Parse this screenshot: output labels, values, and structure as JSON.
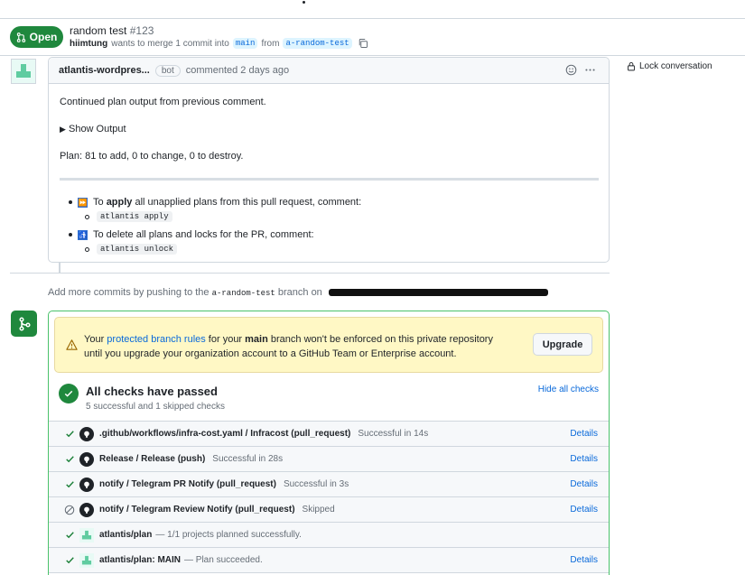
{
  "pr": {
    "state": "Open",
    "title": "random test",
    "number": "#123",
    "author": "hiimtung",
    "merge_text": "wants to merge 1 commit into",
    "base_branch": "main",
    "from_text": "from",
    "head_branch": "a-random-test"
  },
  "comment": {
    "author": "atlantis-wordpres...",
    "badge": "bot",
    "time": "commented 2 days ago",
    "intro": "Continued plan output from previous comment.",
    "show_output": "Show Output",
    "plan": "Plan: 81 to add, 0 to change, 0 to destroy.",
    "apply_prefix": "To ",
    "apply_bold": "apply",
    "apply_rest": " all unapplied plans from this pull request, comment:",
    "apply_cmd": "atlantis apply",
    "unlock_text": "To delete all plans and locks for the PR, comment:",
    "unlock_cmd": "atlantis unlock"
  },
  "sidebar": {
    "lock_label": "Lock conversation"
  },
  "add_commits": {
    "prefix": "Add more commits by pushing to the",
    "branch": "a-random-test",
    "suffix": "branch on"
  },
  "warning": {
    "part1": "Your ",
    "link": "protected branch rules",
    "part2": " for your ",
    "branch": "main",
    "part3": " branch won't be enforced on this private repository until you upgrade your organization account to a GitHub Team or Enterprise account.",
    "button": "Upgrade"
  },
  "checks": {
    "title": "All checks have passed",
    "subtitle": "5 successful and 1 skipped checks",
    "hide_label": "Hide all checks",
    "rows": [
      {
        "status": "success",
        "icon": "github",
        "name": ".github/workflows/infra-cost.yaml / Infracost (pull_request)",
        "desc": "Successful in 14s",
        "details": "Details"
      },
      {
        "status": "success",
        "icon": "github",
        "name": "Release / Release (push)",
        "desc": "Successful in 28s",
        "details": "Details"
      },
      {
        "status": "success",
        "icon": "github",
        "name": "notify / Telegram PR Notify (pull_request)",
        "desc": "Successful in 3s",
        "details": "Details"
      },
      {
        "status": "skipped",
        "icon": "github",
        "name": "notify / Telegram Review Notify (pull_request)",
        "desc": "Skipped",
        "details": "Details"
      },
      {
        "status": "success",
        "icon": "atlantis",
        "name": "atlantis/plan",
        "desc": "— 1/1 projects planned successfully.",
        "details": ""
      },
      {
        "status": "success",
        "icon": "atlantis",
        "name": "atlantis/plan: MAIN",
        "desc": "— Plan succeeded.",
        "details": "Details"
      }
    ]
  }
}
